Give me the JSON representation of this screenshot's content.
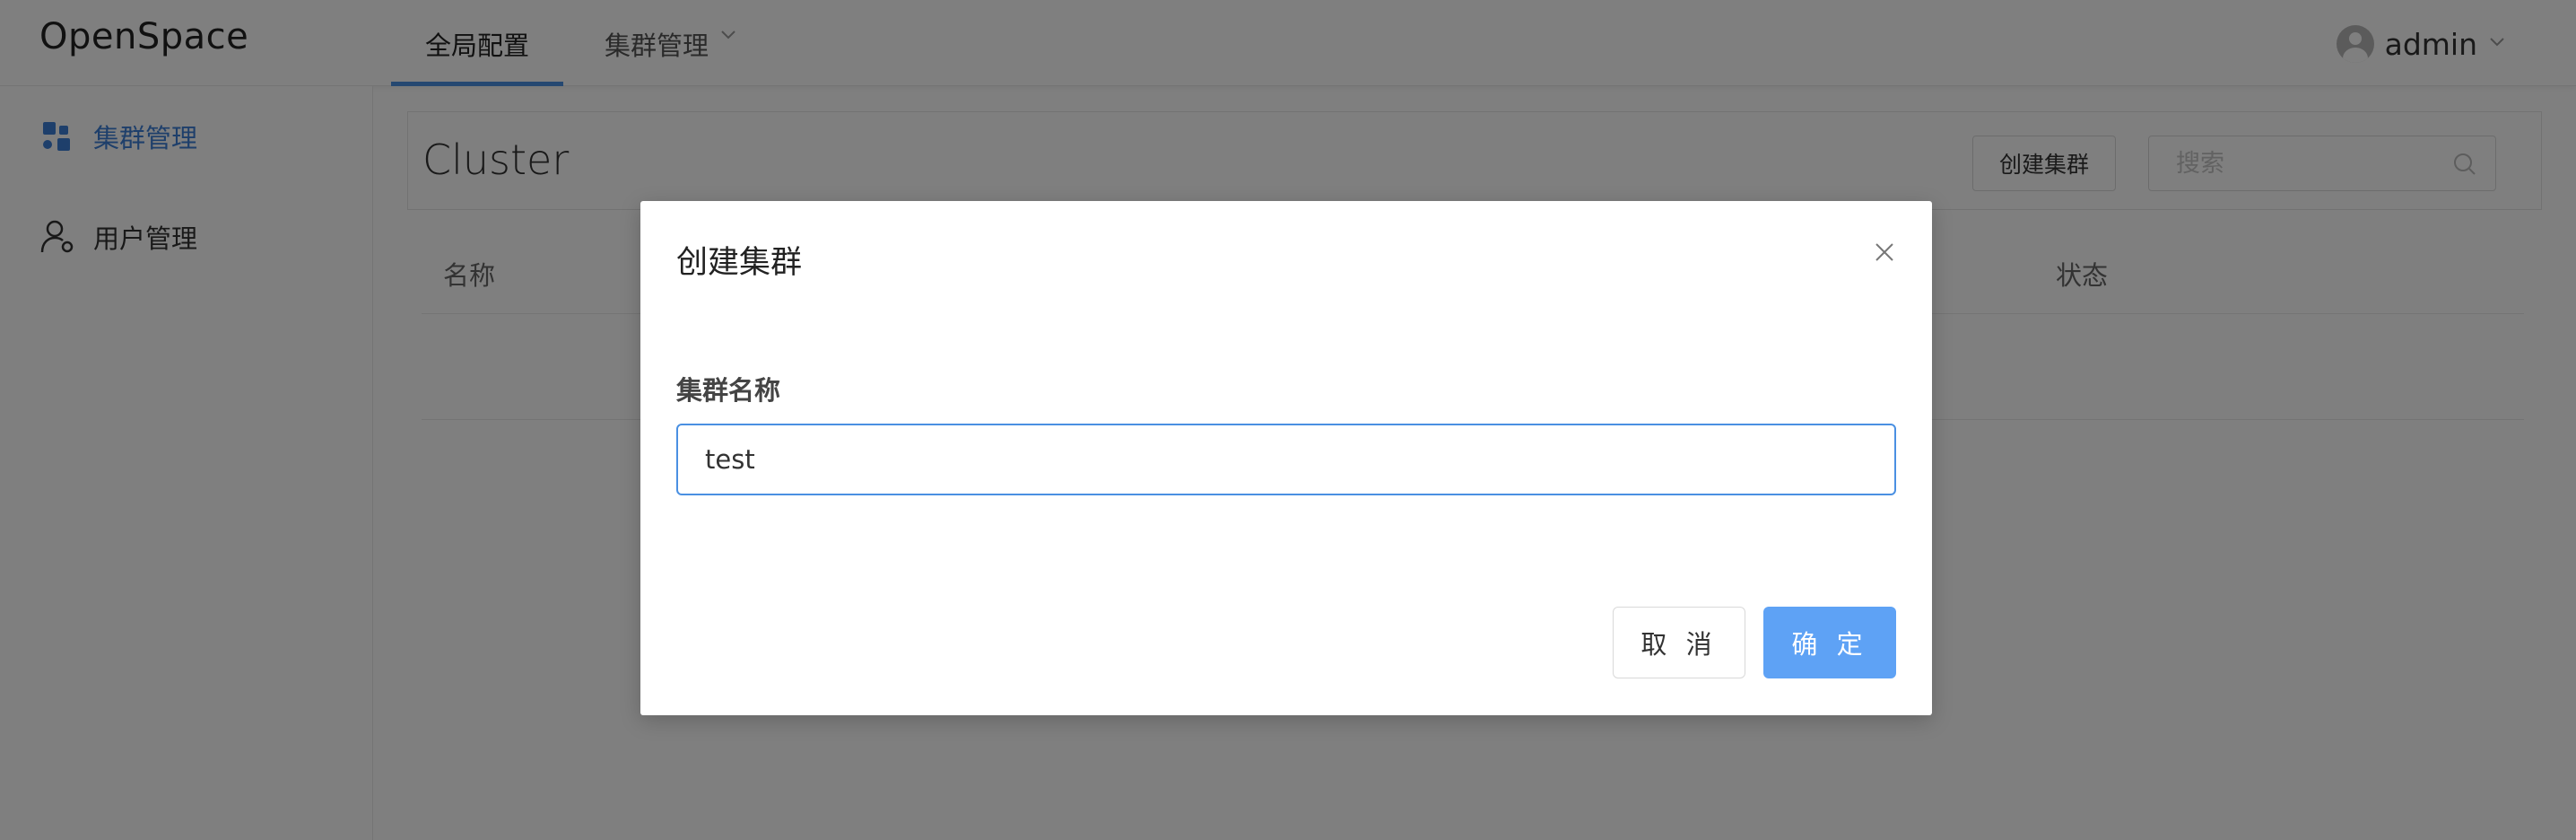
{
  "app": {
    "logo": "OpenSpace"
  },
  "header": {
    "tabs": [
      {
        "label": "全局配置",
        "active": true
      },
      {
        "label": "集群管理",
        "active": false,
        "has_dropdown": true
      }
    ],
    "user": {
      "name": "admin",
      "avatar_icon": "user-avatar-icon"
    }
  },
  "sidebar": {
    "items": [
      {
        "label": "集群管理",
        "icon": "cluster-icon",
        "active": true
      },
      {
        "label": "用户管理",
        "icon": "user-settings-icon",
        "active": false
      }
    ]
  },
  "main": {
    "title": "Cluster",
    "create_button": "创建集群",
    "search": {
      "placeholder": "搜索",
      "value": ""
    },
    "table": {
      "columns": [
        "名称",
        "状态"
      ]
    }
  },
  "modal": {
    "title": "创建集群",
    "field_label": "集群名称",
    "field_value": "test",
    "cancel_label": "取 消",
    "ok_label": "确 定"
  },
  "colors": {
    "accent": "#4a90e2",
    "primary_button": "#5ea2f5",
    "active_sidebar": "#3d7fd6",
    "overlay": "rgba(0,0,0,0.5)"
  }
}
